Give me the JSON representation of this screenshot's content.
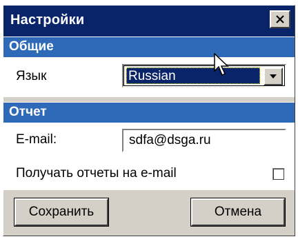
{
  "window": {
    "title": "Настройки",
    "close_label": "Close"
  },
  "sections": {
    "general": {
      "title": "Общие",
      "language_label": "Язык",
      "language_value": "Russian"
    },
    "report": {
      "title": "Отчет",
      "email_label": "E-mail:",
      "email_value": "sdfa@dsga.ru",
      "receive_reports_label": "Получать отчеты на e-mail",
      "receive_reports_checked": false
    }
  },
  "buttons": {
    "save_label": "Сохранить",
    "cancel_label": "Отмена"
  },
  "icons": {
    "close": "close-icon",
    "dropdown": "chevron-down-icon",
    "cursor": "mouse-pointer-icon"
  },
  "colors": {
    "titlebar": "#0a246a",
    "section_header": "#2e6ab8",
    "dialog_face": "#d4d0c8",
    "selection": "#0a246a"
  }
}
